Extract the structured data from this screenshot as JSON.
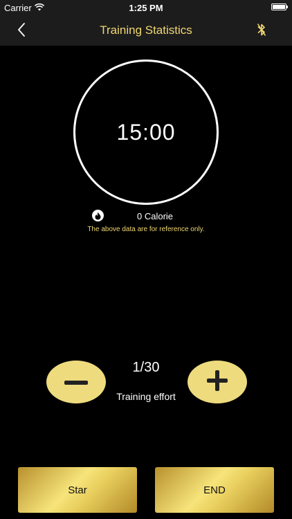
{
  "status_bar": {
    "carrier": "Carrier",
    "time": "1:25 PM",
    "wifi_icon": "wifi-icon",
    "battery_icon": "battery-icon"
  },
  "nav": {
    "title": "Training Statistics",
    "back_icon": "chevron-left-icon",
    "bluetooth_icon": "bluetooth-icon"
  },
  "timer": {
    "value": "15:00"
  },
  "calorie": {
    "icon": "flame-icon",
    "text": "0 Calorie"
  },
  "disclaimer": "The above data are for reference only.",
  "effort": {
    "count": "1/30",
    "label": "Training effort",
    "decrease_icon": "minus-icon",
    "increase_icon": "plus-icon"
  },
  "actions": {
    "start_label": "Star",
    "end_label": "END"
  },
  "colors": {
    "accent_gold": "#f0d772",
    "button_gold": "#eedb7e",
    "background": "#000000",
    "bar_background": "#1c1c1c"
  }
}
